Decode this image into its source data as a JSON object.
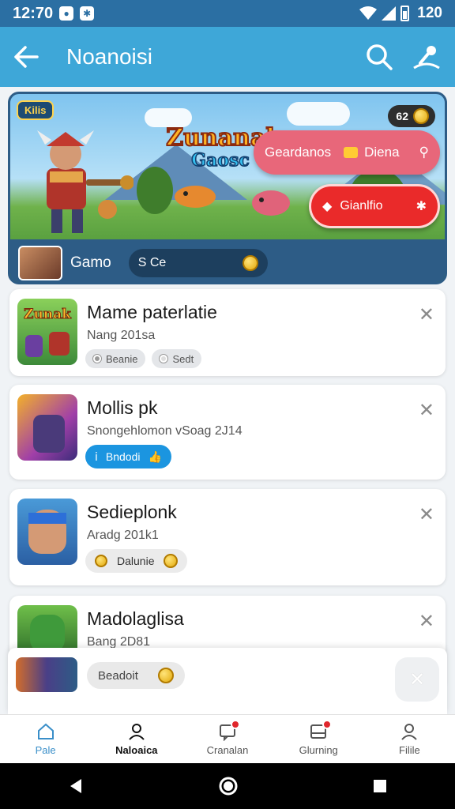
{
  "status_bar": {
    "time": "12:70",
    "battery": "120"
  },
  "app_bar": {
    "title": "Noanoisi"
  },
  "hero": {
    "logo_line1": "Zunanal",
    "logo_line2": "Gaosc",
    "top_left_chip": "Kilis",
    "coin_chip": "62",
    "pill1_left": "Geardanos",
    "pill1_right": "Diena",
    "pill2": "Gianlfio",
    "bottom_label": "Gamo",
    "bottom_field": "S Ce"
  },
  "cards": [
    {
      "name": "Mame paterlatie",
      "sub": "Nang 201sa",
      "chips": [
        "Beanie",
        "Sedt"
      ],
      "icon_text": "Zunak"
    },
    {
      "name": "Mollis pk",
      "sub": "Snongehlomon vSoag 2J14",
      "button": "Bndodi"
    },
    {
      "name": "Sedieplonk",
      "sub": "Aradg 201k1",
      "button": "Dalunie"
    },
    {
      "name": "Madolaglisa",
      "sub": "Bang 2D81"
    }
  ],
  "float_bar": {
    "pill": "Beadoit"
  },
  "bottom_nav": [
    {
      "label": "Pale",
      "icon": "home-icon"
    },
    {
      "label": "Naloaica",
      "icon": "user-icon"
    },
    {
      "label": "Cranalan",
      "icon": "chat-icon"
    },
    {
      "label": "Glurning",
      "icon": "inbox-icon"
    },
    {
      "label": "Filile",
      "icon": "profile-icon"
    }
  ],
  "colors": {
    "primary": "#3ea7d8",
    "status": "#2b6fa3",
    "accent_red": "#ea2a2a",
    "accent_blue": "#1b95e0"
  }
}
